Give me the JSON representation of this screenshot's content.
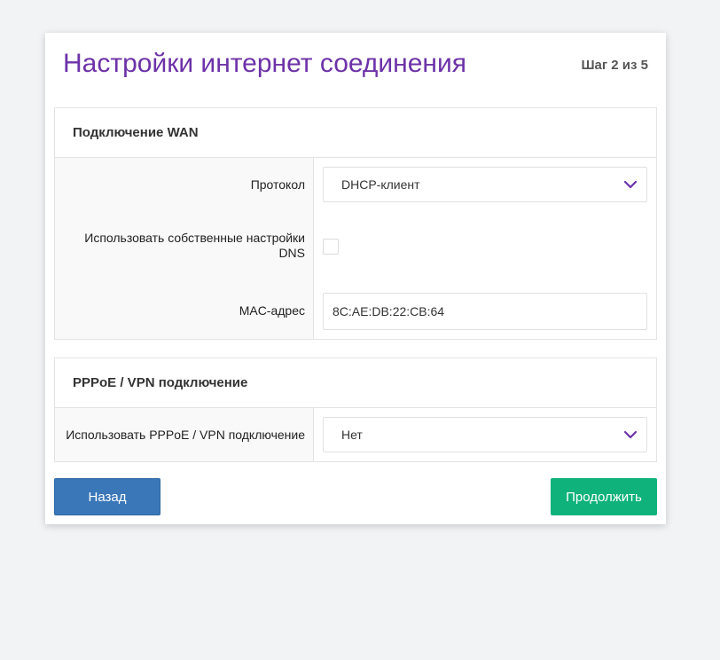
{
  "header": {
    "title": "Настройки интернет соединения",
    "step": "Шаг 2 из 5"
  },
  "wan": {
    "title": "Подключение WAN",
    "protocol_label": "Протокол",
    "protocol_value": "DHCP-клиент",
    "dns_label_line1": "Использовать собственные настройки",
    "dns_label_line2": "DNS",
    "dns_checked": false,
    "mac_label": "MAC-адрес",
    "mac_value": "8C:AE:DB:22:CB:64"
  },
  "pppoe": {
    "title": "PPPoE / VPN подключение",
    "use_label": "Использовать PPPoE / VPN подключение",
    "use_value": "Нет"
  },
  "buttons": {
    "back": "Назад",
    "next": "Продолжить"
  },
  "colors": {
    "title": "#6d32a8",
    "chevron": "#6d32a8",
    "back_button": "#3a77b8",
    "next_button": "#0fb27b"
  },
  "icons": {
    "dropdown": "chevron-down-icon"
  }
}
